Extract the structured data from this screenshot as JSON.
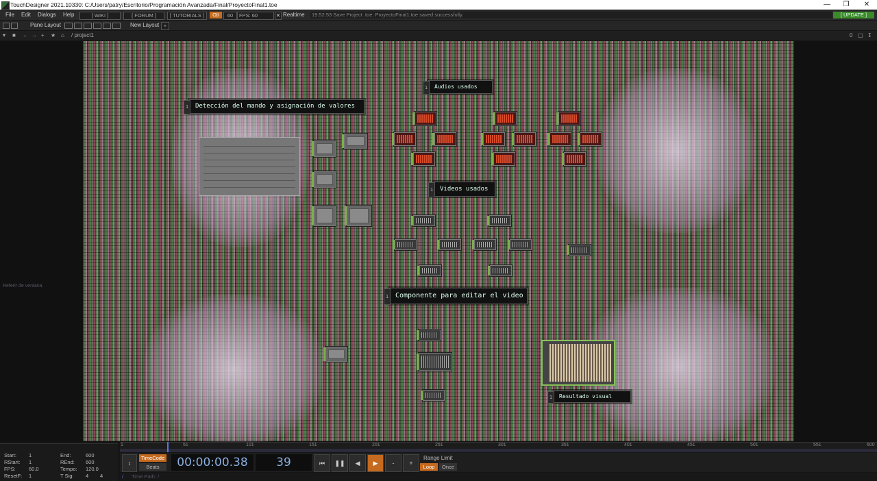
{
  "window": {
    "title": "TouchDesigner 2021.10330: C:/Users/patry/Escritorio/Programación Avanzada/Final/ProyectoFinal1.toe"
  },
  "menubar": {
    "items": [
      "File",
      "Edit",
      "Dialogs",
      "Help"
    ],
    "wiki": "[ WIKI ]",
    "forum": "[ FORUM ]",
    "tutorials": "[ TUTORIALS ]",
    "oi": "O|I",
    "sixty": "60",
    "fps_label": "FPS: 60",
    "realtime": "Realtime",
    "status": "19:52:53 Save Project .toe: ProyectoFinal1.toe saved successfully.",
    "update": "[ UPDATE ]",
    "accent": "#c56a1e",
    "update_color": "#3c8a2a"
  },
  "panebar": {
    "pane_layout": "Pane Layout",
    "new_layout": "New Layout",
    "plus": "+"
  },
  "pathbar": {
    "path": "/ project1",
    "zero": "0"
  },
  "network": {
    "comments": {
      "deteccion": "Detección del mando y asignación de valores",
      "audios": "Audios usados",
      "videos": "Videos usados",
      "componente": "Componente para editar el video",
      "resultado": "Resultado visual"
    },
    "comment_num": "1",
    "pane_ref": "Referir de ventana"
  },
  "timeline": {
    "ticks": [
      "1",
      "51",
      "101",
      "151",
      "201",
      "251",
      "301",
      "351",
      "401",
      "451",
      "501",
      "551",
      "600"
    ],
    "timecode": "00:00:00.38",
    "frame": "39",
    "timecode_btn": "TimeCode",
    "beats_btn": "Beats",
    "range_limit": "Range Limit",
    "loop": "Loop",
    "once": "Once",
    "minus": "-",
    "plus": "+",
    "time_path": "Time Path: /"
  },
  "info": {
    "start_label": "Start:",
    "start": "1",
    "end_label": "End:",
    "end": "600",
    "rstart_label": "RStart:",
    "rstart": "1",
    "rend_label": "REnd:",
    "rend": "600",
    "fps_label": "FPS:",
    "fps": "60.0",
    "tempo_label": "Tempo:",
    "tempo": "120.0",
    "resetf_label": "ResetF:",
    "resetf": "1",
    "tsig_label": "T Sig:",
    "tsig_a": "4",
    "tsig_b": "4"
  }
}
